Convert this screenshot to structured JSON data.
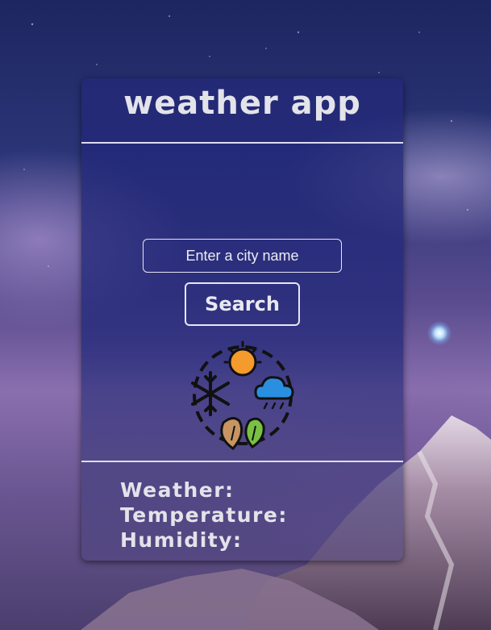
{
  "app": {
    "title": "weather app"
  },
  "search": {
    "placeholder": "Enter a city name",
    "value": "",
    "button_label": "Search"
  },
  "icon": {
    "name": "seasons-weather-icon"
  },
  "results": {
    "weather_label": "Weather:",
    "temperature_label": "Temperature:",
    "humidity_label": "Humidity:"
  },
  "colors": {
    "card": "#232878",
    "text": "#e3e3ea",
    "sun": "#f59a2c",
    "cloud": "#2a8fe0",
    "leaf_green": "#79c142",
    "leaf_brown": "#c79462"
  }
}
